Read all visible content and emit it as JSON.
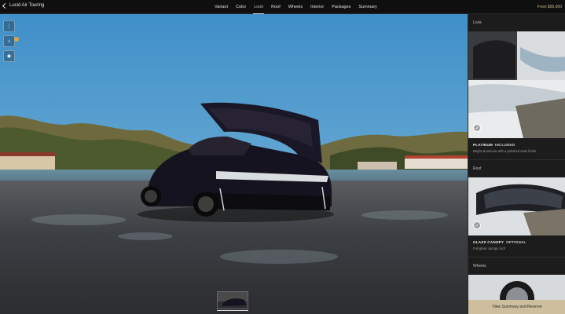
{
  "header": {
    "back_label": "Lucid Air Touring",
    "tabs": [
      {
        "label": "Variant"
      },
      {
        "label": "Color"
      },
      {
        "label": "Look"
      },
      {
        "label": "Roof"
      },
      {
        "label": "Wheels"
      },
      {
        "label": "Interior"
      },
      {
        "label": "Packages"
      },
      {
        "label": "Summary"
      }
    ],
    "active_tab": "Look",
    "price": "From $95,000"
  },
  "viewer": {
    "tools": [
      "more-icon",
      "rotate-icon",
      "camera-icon"
    ]
  },
  "panel": {
    "look": {
      "title": "Look",
      "option_name": "PLATINUM",
      "option_tag": "INCLUDED",
      "option_desc": "Bright aluminum with a polished satin finish"
    },
    "roof": {
      "title": "Roof",
      "option_name": "GLASS CANOPY",
      "option_tag": "OPTIONAL",
      "option_desc": "Full glass canopy roof"
    },
    "wheels": {
      "title": "Wheels"
    },
    "cta_label": "View Summary and Reserve"
  },
  "colors": {
    "accent": "#cdbf9d",
    "price": "#c9b38a",
    "panel_bg": "#1c1c1c"
  }
}
